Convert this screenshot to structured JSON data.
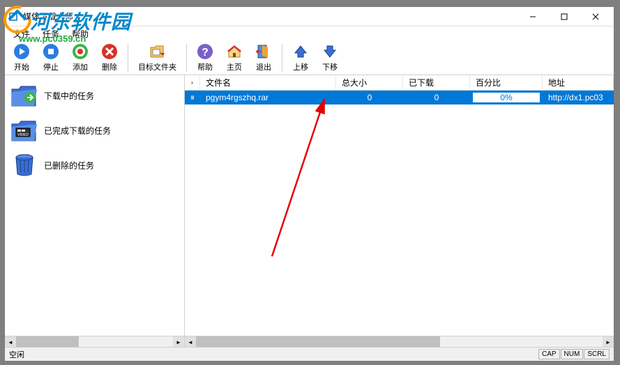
{
  "window": {
    "title": "媒体下载大师"
  },
  "menu": {
    "file": "文件",
    "task": "任务",
    "help": "帮助"
  },
  "toolbar": {
    "start": "开始",
    "stop": "停止",
    "add": "添加",
    "delete": "删除",
    "targetFolder": "目标文件夹",
    "help": "帮助",
    "home": "主页",
    "exit": "退出",
    "moveUp": "上移",
    "moveDown": "下移"
  },
  "sidebar": {
    "downloading": "下载中的任务",
    "completed": "已完成下载的任务",
    "deleted": "已删除的任务"
  },
  "columns": {
    "filename": "文件名",
    "totalSize": "总大小",
    "downloaded": "已下载",
    "percent": "百分比",
    "address": "地址"
  },
  "row": {
    "filename": "pgym4rgszhq.rar",
    "totalSize": "0",
    "downloaded": "0",
    "percent": "0%",
    "address": "http://dx1.pc03"
  },
  "status": {
    "idle": "空闲",
    "cap": "CAP",
    "num": "NUM",
    "scrl": "SCRL"
  },
  "watermark": {
    "cn": "河东软件园",
    "en": "www.pc0359.cn"
  }
}
